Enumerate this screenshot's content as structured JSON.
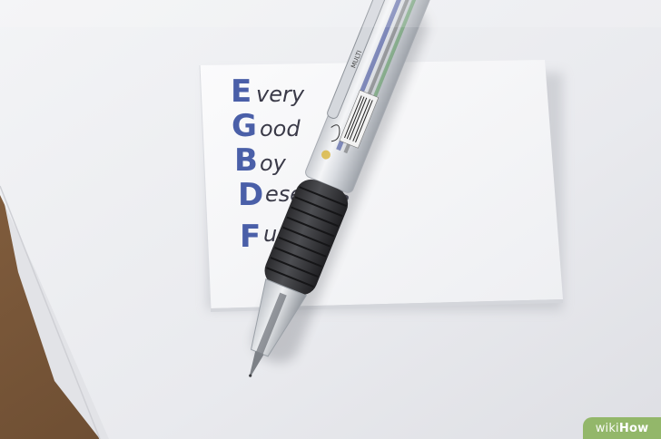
{
  "photo": {
    "subject": "multi-color ballpoint pen on note pad",
    "mnemonic": {
      "letters": [
        "E",
        "G",
        "B",
        "D",
        "F"
      ],
      "words": [
        "very",
        "ood",
        "oy",
        "eserves",
        "udge."
      ],
      "letter_color": "#4a5fa8",
      "word_color": "#3a3a48"
    },
    "pen_print": "MULTI"
  },
  "watermark": {
    "part1": "wiki",
    "part2": "How"
  }
}
